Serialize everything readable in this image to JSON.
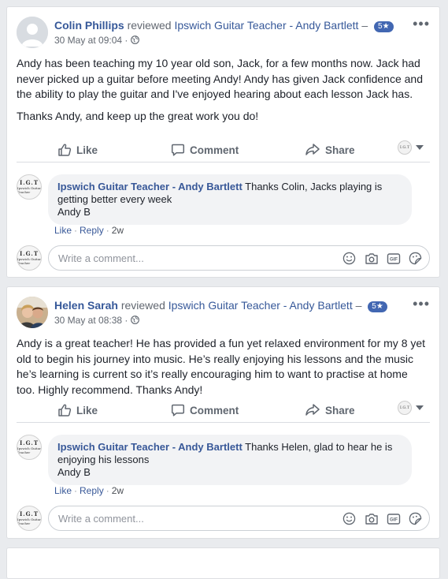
{
  "posts": [
    {
      "author": "Colin Phillips",
      "verb": "reviewed",
      "page": "Ipswich Guitar Teacher - Andy Bartlett",
      "dash": " –",
      "rating": "5★",
      "date": "30 May at 09:04 · ",
      "paragraphs": [
        "Andy has been teaching my 10 year old son, Jack, for a few months now. Jack had never picked up a guitar before meeting Andy! Andy has given Jack confidence and the ability to play the guitar and I've enjoyed hearing about each lesson Jack has.",
        "Thanks Andy, and keep up the great work you do!"
      ],
      "reply": {
        "name": "Ipswich Guitar Teacher - Andy Bartlett",
        "text": " Thanks Colin, Jacks playing is getting better every week",
        "sign": "Andy B",
        "like": "Like",
        "reply_label": "Reply",
        "age": "2w"
      }
    },
    {
      "author": "Helen Sarah",
      "verb": "reviewed",
      "page": "Ipswich Guitar Teacher - Andy Bartlett",
      "dash": " –",
      "rating": "5★",
      "date": "30 May at 08:38 · ",
      "paragraphs": [
        "Andy is a great teacher! He has provided a fun yet relaxed environment for my 8 yet old to begin his journey into music. He’s really enjoying his lessons and the music he’s learning is current so it’s really encouraging him to want to practise at home too. Highly recommend. Thanks Andy!"
      ],
      "reply": {
        "name": "Ipswich Guitar Teacher - Andy Bartlett",
        "text": " Thanks Helen, glad to hear he is enjoying his lessons",
        "sign": "Andy B",
        "like": "Like",
        "reply_label": "Reply",
        "age": "2w"
      }
    }
  ],
  "actions": {
    "like": "Like",
    "comment": "Comment",
    "share": "Share"
  },
  "composer": {
    "placeholder": "Write a comment..."
  },
  "logo": {
    "line1": "I.G.T",
    "line2": "Ipswich Guitar Teacher"
  },
  "icons": [
    "more-icon",
    "globe-icon",
    "like-icon",
    "comment-icon",
    "share-icon",
    "emoji-icon",
    "camera-icon",
    "gif-icon",
    "sticker-icon"
  ],
  "colors": {
    "link": "#365899",
    "background": "#e9ebee",
    "pill": "#4267b2"
  }
}
